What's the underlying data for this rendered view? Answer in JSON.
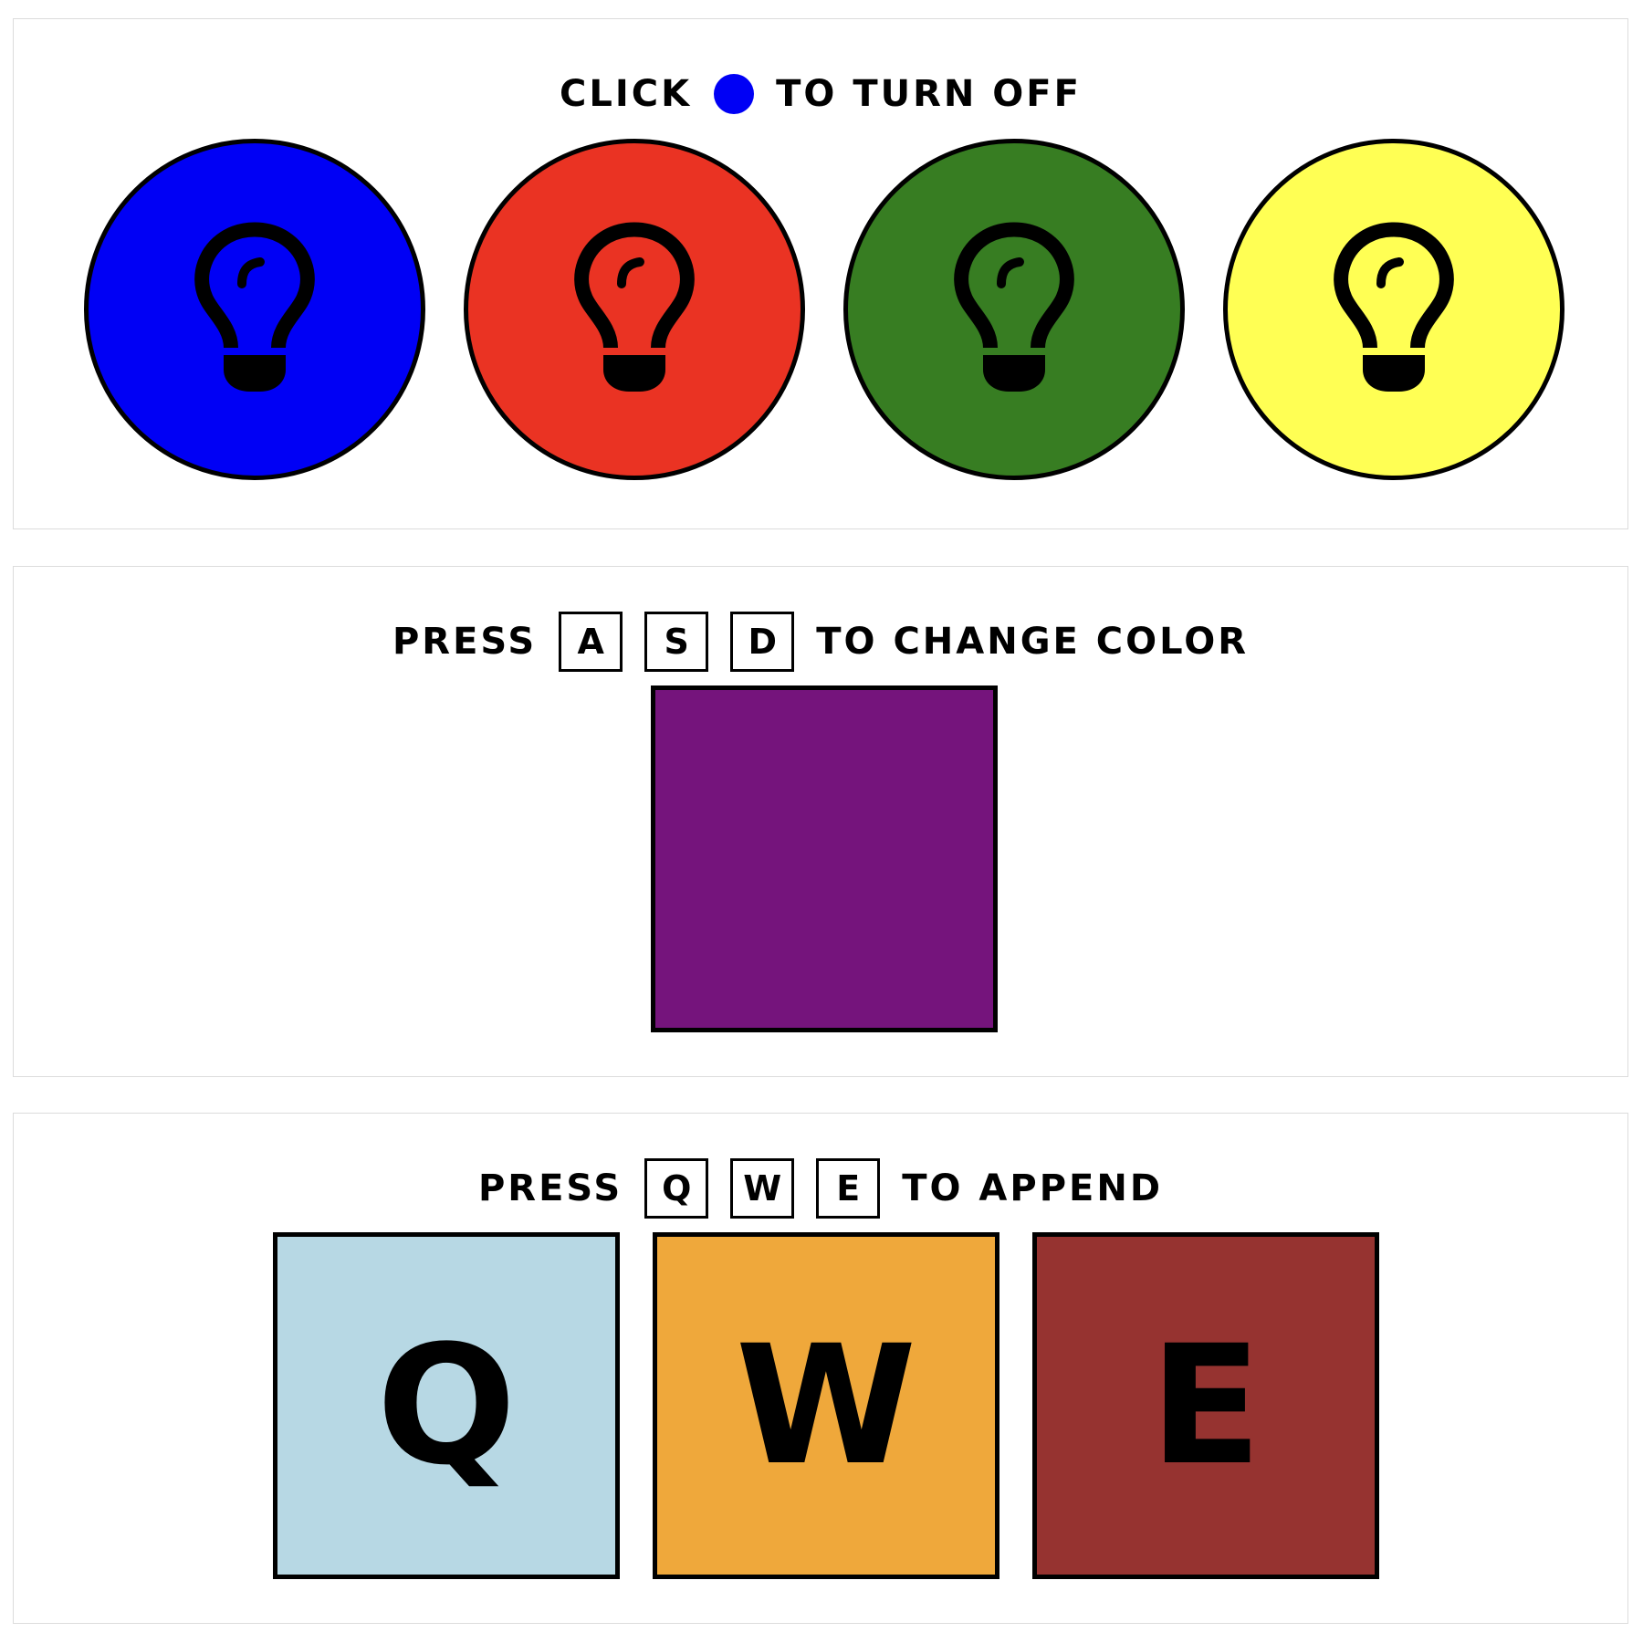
{
  "lights_panel": {
    "instruction": {
      "before": "CLICK",
      "after": "TO TURN OFF",
      "dot_color": "#0000f5"
    },
    "lights": [
      {
        "color": "#0000f5",
        "icon": "lightbulb-icon"
      },
      {
        "color": "#ea3323",
        "icon": "lightbulb-icon"
      },
      {
        "color": "#377d22",
        "icon": "lightbulb-icon"
      },
      {
        "color": "#ffff54",
        "icon": "lightbulb-icon"
      }
    ]
  },
  "color_panel": {
    "instruction": {
      "before": "PRESS",
      "keys": [
        "A",
        "S",
        "D"
      ],
      "after": "TO CHANGE COLOR"
    },
    "current_color": "#75147c"
  },
  "append_panel": {
    "instruction": {
      "before": "PRESS",
      "keys": [
        "Q",
        "W",
        "E"
      ],
      "after": "TO APPEND"
    },
    "tiles": [
      {
        "letter": "Q",
        "color": "#b7d8e4"
      },
      {
        "letter": "W",
        "color": "#efa83b"
      },
      {
        "letter": "E",
        "color": "#963330"
      }
    ]
  }
}
